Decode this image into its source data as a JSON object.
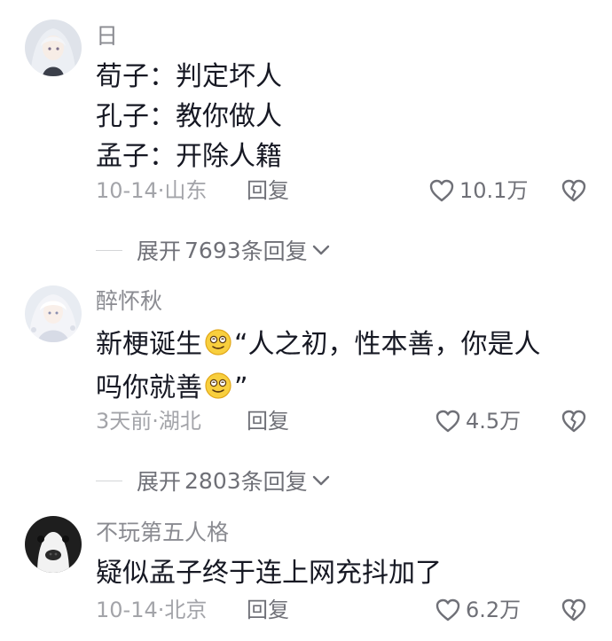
{
  "comments": [
    {
      "username": "日",
      "lines": [
        "荀子：判定坏人",
        "孔子：教你做人",
        "孟子：开除人籍"
      ],
      "date": "10-14·山东",
      "reply_label": "回复",
      "likes": "10.1万",
      "avatar_icon": "anime-avatar-icon",
      "expand": {
        "prefix": "展开",
        "count": "7693",
        "suffix": "条回复"
      }
    },
    {
      "username": "醉怀秋",
      "line1_a": "新梗诞生",
      "line1_b": "“人之初，性本善，你是人",
      "line2_a": "吗你就善",
      "line2_b": "”",
      "date": "3天前·湖北",
      "reply_label": "回复",
      "likes": "4.5万",
      "avatar_icon": "anime-avatar-icon",
      "emoji_icon": "dizzy-face-emoji-icon",
      "expand": {
        "prefix": "展开",
        "count": "2803",
        "suffix": "条回复"
      }
    },
    {
      "username": "不玩第五人格",
      "lines": [
        "疑似孟子终于连上网充抖加了"
      ],
      "date": "10-14·北京",
      "reply_label": "回复",
      "likes": "6.2万",
      "avatar_icon": "dog-avatar-icon"
    }
  ],
  "icons": {
    "like": "heart-outline-icon",
    "dislike": "broken-heart-icon",
    "expand": "chevron-down-icon"
  },
  "colors": {
    "text_primary": "#161823",
    "text_secondary": "#8a8b91",
    "meta": "#a3a4a9",
    "action": "#6f7077"
  }
}
